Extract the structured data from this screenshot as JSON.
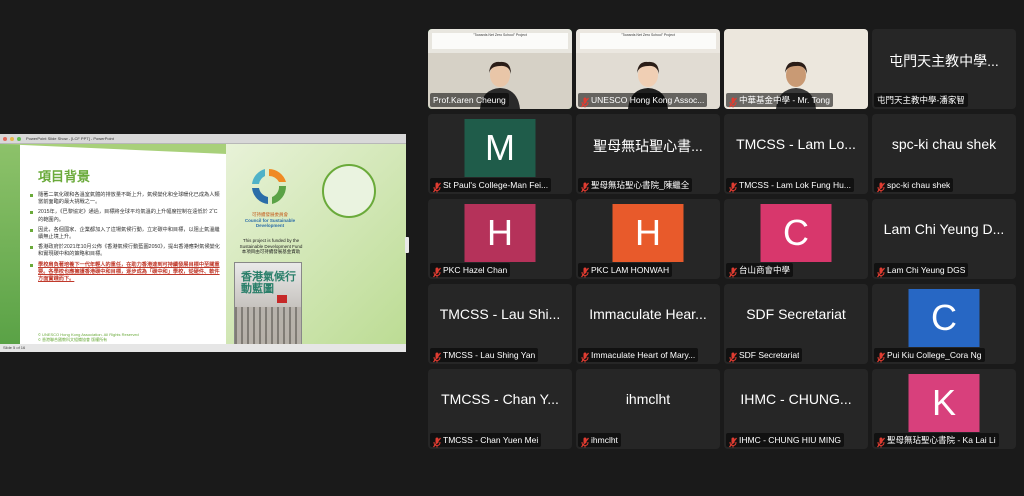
{
  "share": {
    "window_title": "PowerPoint Slide Show - [LCF PPT] - PowerPoint",
    "slide": {
      "title": "項目背景",
      "bullets": [
        {
          "text": "隨著二氧化碳和各溫室氣體的排放量不斷上升，氣候變化和全球暖化已成為人類當前面臨的最大挑戰之一。",
          "highlight": false
        },
        {
          "text": "2015年，《巴黎協定》通過，目標將全球平均氣溫的上升幅度控制在遠低於 2˚C 的範圍內。",
          "highlight": false
        },
        {
          "text": "因此，各個國家、企業都加入了這場氣候行動，立定碳中和目標，以阻止氣溫繼續無止境上升。",
          "highlight": false
        },
        {
          "text": "香港政府於2021年10月公佈《香港氣候行動藍圖2050》，提出香港應對氣候變化和實現碳中和的策略和目標。",
          "highlight": false
        },
        {
          "text": "學校肩負著培養下一代年輕人的重任，在助力香港達到可持續發展目標中至關重要。各學校也應擁護香港碳中和目標，逐步成為「碳中和」學校，從硬件、軟件方面實踐而下。",
          "highlight": true
        }
      ],
      "footer_line1": "© UNESCO Hong Kong Association. All Rights Reserved",
      "footer_line2": "© 香港聯合國教科文組織協會 版權所有",
      "council_zh": "可持續發展委員會",
      "council_en": "Council for Sustainable Development",
      "fund_text": "This project is funded by the Sustainable Development Fund",
      "fund_zh": "本項目由可持續發展基金資助",
      "book_title": "香港氣候行動藍圖",
      "book_year": "2050"
    },
    "status": "Slide 5 of 16"
  },
  "banner_text": "\"Towards Net Zero School\" Project",
  "tiles": [
    {
      "type": "video",
      "name": "Prof.Karen Cheung",
      "muted": false,
      "active": true,
      "bg": "vid-bg-1",
      "banner": true,
      "shirt": "#2a2a2a",
      "skin": "#e9c6a8"
    },
    {
      "type": "video",
      "name": "UNESCO Hong Kong Assoc...",
      "muted": true,
      "active": false,
      "bg": "vid-bg-2",
      "banner": true,
      "shirt": "#1f1f1f",
      "skin": "#f0cfb4"
    },
    {
      "type": "video",
      "name": "中華基金中學 - Mr. Tong",
      "muted": true,
      "active": false,
      "bg": "vid-bg-3",
      "banner": false,
      "shirt": "#3a3a3a",
      "skin": "#c99a74"
    },
    {
      "type": "text",
      "display": "屯門天主教中學...",
      "name": "屯門天主教中學-潘家智",
      "muted": false
    },
    {
      "type": "avatar",
      "letter": "M",
      "color": "#1f5c4a",
      "name": "St Paul's College-Man Fei...",
      "muted": true
    },
    {
      "type": "text",
      "display": "聖母無玷聖心書...",
      "name": "聖母無玷聖心書院_陳繼全",
      "muted": true
    },
    {
      "type": "text",
      "display": "TMCSS - Lam Lo...",
      "name": "TMCSS - Lam Lok Fung Hu...",
      "muted": true
    },
    {
      "type": "text",
      "display": "spc-ki chau shek",
      "name": "spc-ki chau shek",
      "muted": true
    },
    {
      "type": "avatar",
      "letter": "H",
      "color": "#b5325a",
      "name": "PKC Hazel Chan",
      "muted": true
    },
    {
      "type": "avatar",
      "letter": "H",
      "color": "#e85a2b",
      "name": "PKC LAM HONWAH",
      "muted": true
    },
    {
      "type": "avatar",
      "letter": "C",
      "color": "#d8376c",
      "name": "台山商會中學",
      "muted": true
    },
    {
      "type": "text",
      "display": "Lam Chi Yeung D...",
      "name": "Lam Chi Yeung DGS",
      "muted": true
    },
    {
      "type": "text",
      "display": "TMCSS - Lau Shi...",
      "name": "TMCSS - Lau Shing Yan",
      "muted": true
    },
    {
      "type": "text",
      "display": "Immaculate Hear...",
      "name": "Immaculate Heart of Mary...",
      "muted": true
    },
    {
      "type": "text",
      "display": "SDF Secretariat",
      "name": "SDF Secretariat",
      "muted": true
    },
    {
      "type": "avatar",
      "letter": "C",
      "color": "#2767c4",
      "name": "Pui Kiu College_Cora Ng",
      "muted": true
    },
    {
      "type": "text",
      "display": "TMCSS - Chan Y...",
      "name": "TMCSS - Chan Yuen Mei",
      "muted": true
    },
    {
      "type": "text",
      "display": "ihmclht",
      "name": "ihmclht",
      "muted": true
    },
    {
      "type": "text",
      "display": "IHMC - CHUNG...",
      "name": "IHMC - CHUNG HIU MING",
      "muted": true
    },
    {
      "type": "avatar",
      "letter": "K",
      "color": "#d8407c",
      "name": "聖母無玷聖心書院 - Ka Lai Li",
      "muted": true
    }
  ]
}
